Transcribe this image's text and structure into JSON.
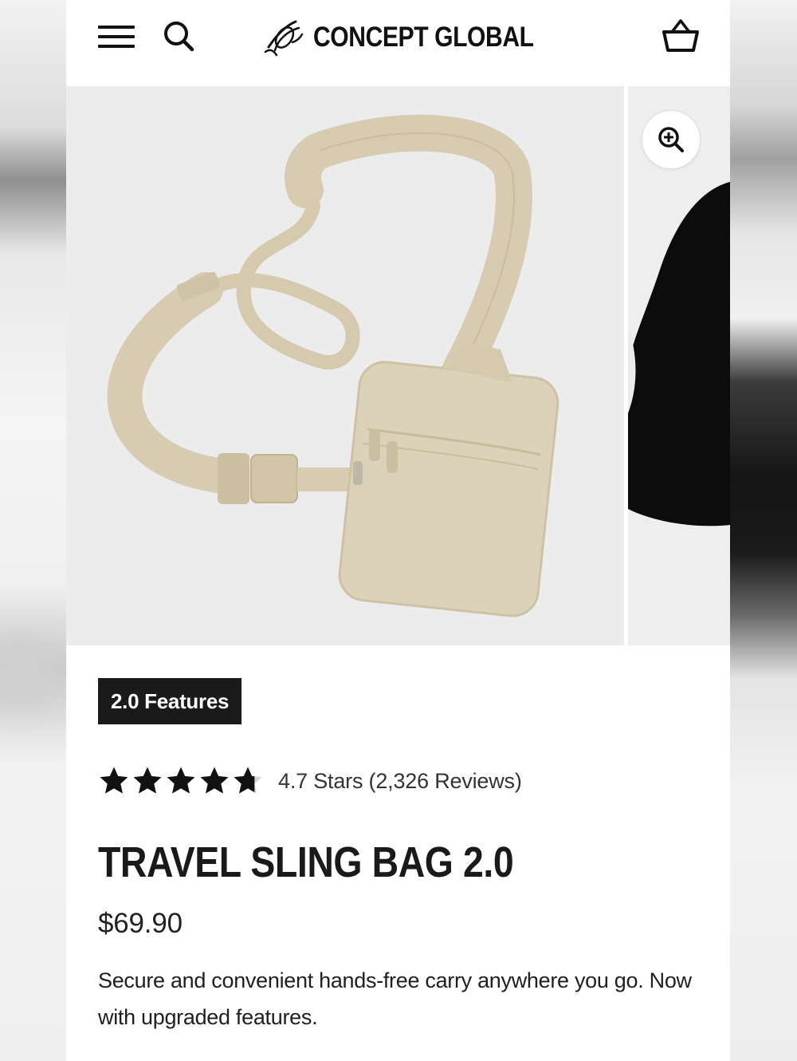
{
  "header": {
    "menu_icon": "hamburger-menu-icon",
    "search_icon": "search-icon",
    "brand_name": "CONCEPT GLOBAL",
    "cart_icon": "shopping-basket-icon"
  },
  "gallery": {
    "zoom_icon": "zoom-in-icon",
    "main_image": "beige-travel-sling-bag-product-photo",
    "next_image": "model-wearing-black-shirt-photo"
  },
  "product": {
    "badge": "2.0 Features",
    "rating": {
      "value": 4.7,
      "max": 5,
      "text": "4.7 Stars (2,326 Reviews)"
    },
    "title": "TRAVEL SLING BAG 2.0",
    "price": "$69.90",
    "description": "Secure and convenient hands-free carry anywhere you go. Now with upgraded features."
  },
  "colors": {
    "text": "#1a1a1a",
    "badge_bg": "#1a1a1a",
    "image_bg": "#ececec",
    "bag": "#d9cfb7"
  }
}
